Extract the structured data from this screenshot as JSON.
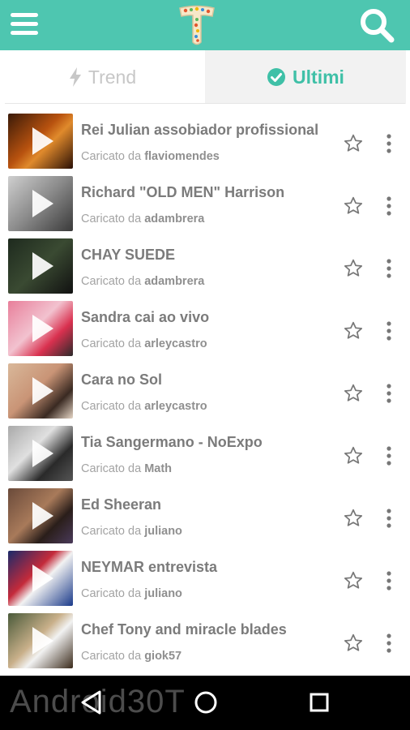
{
  "app": {
    "logo_letter": "T",
    "accent": "#4ec6b0"
  },
  "tabs": [
    {
      "label": "Trend",
      "icon": "bolt-icon",
      "active": false
    },
    {
      "label": "Ultimi",
      "icon": "check-circle-icon",
      "active": true
    }
  ],
  "videos": [
    {
      "title": "Rei Julian assobiador profissional",
      "prefix": "Caricato da",
      "user": "flaviomendes"
    },
    {
      "title": "Richard \"OLD MEN\" Harrison",
      "prefix": "Caricato da",
      "user": "adambrera"
    },
    {
      "title": "CHAY SUEDE",
      "prefix": "Caricato da",
      "user": "adambrera"
    },
    {
      "title": "Sandra cai ao vivo",
      "prefix": "Caricato da",
      "user": "arleycastro"
    },
    {
      "title": "Cara no Sol",
      "prefix": "Caricato da",
      "user": "arleycastro"
    },
    {
      "title": "Tia Sangermano - NoExpo",
      "prefix": "Caricato da",
      "user": "Math"
    },
    {
      "title": "Ed Sheeran",
      "prefix": "Caricato da",
      "user": "juliano"
    },
    {
      "title": "NEYMAR entrevista",
      "prefix": "Caricato da",
      "user": "juliano"
    },
    {
      "title": "Chef Tony and miracle blades",
      "prefix": "Caricato da",
      "user": "giok57"
    }
  ],
  "navbar": {
    "watermark": "Android30T"
  }
}
